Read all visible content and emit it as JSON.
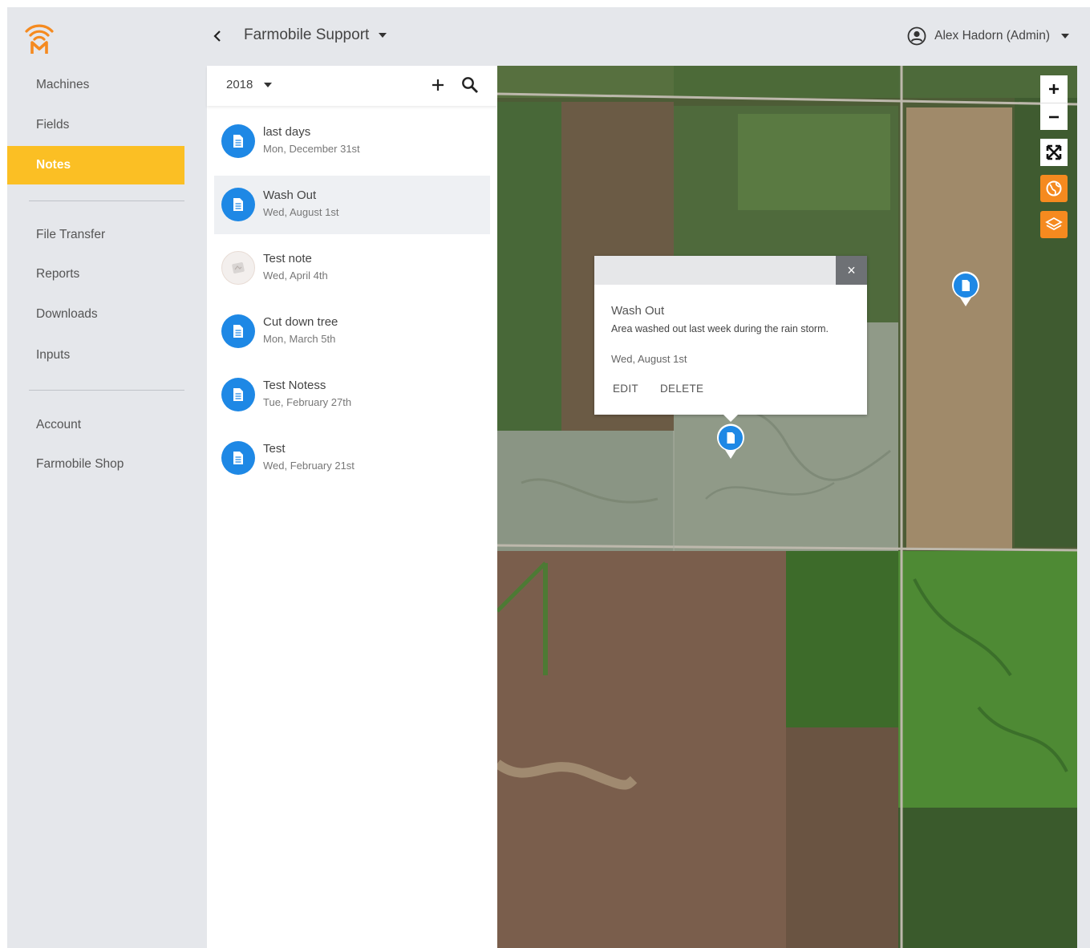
{
  "app": {
    "logo_icon": "farmobile-wifi-logo-icon",
    "brand_color": "#f58a1f"
  },
  "sidebar": {
    "accent": "#fbbf24",
    "items": [
      {
        "label": "Machines"
      },
      {
        "label": "Fields"
      },
      {
        "label": "Notes",
        "active": true
      },
      {
        "label": "File Transfer"
      },
      {
        "label": "Reports"
      },
      {
        "label": "Downloads"
      },
      {
        "label": "Inputs"
      },
      {
        "label": "Account"
      },
      {
        "label": "Farmobile Shop"
      }
    ]
  },
  "header": {
    "back_icon": "chevron-left-icon",
    "org_name": "Farmobile Support",
    "user_name": "Alex Hadorn (Admin)",
    "user_icon": "account-circle-icon"
  },
  "notes": {
    "year": "2018",
    "add_icon": "plus-icon",
    "search_icon": "search-icon",
    "items": [
      {
        "title": "last days",
        "date": "Mon, December 31st",
        "icon": "note-document-icon"
      },
      {
        "title": "Wash Out",
        "date": "Wed, August 1st",
        "icon": "note-document-icon",
        "selected": true
      },
      {
        "title": "Test note",
        "date": "Wed, April 4th",
        "icon": "note-photo-thumbnail"
      },
      {
        "title": "Cut down tree",
        "date": "Mon, March 5th",
        "icon": "note-document-icon"
      },
      {
        "title": "Test Notess",
        "date": "Tue, February 27th",
        "icon": "note-document-icon"
      },
      {
        "title": "Test",
        "date": "Wed, February 21st",
        "icon": "note-document-icon"
      }
    ]
  },
  "map": {
    "controls": [
      "zoom-in-icon",
      "zoom-out-icon",
      "fit-bounds-icon",
      "globe-icon",
      "layers-icon"
    ],
    "pin_color": "#1e88e5",
    "popup": {
      "title": "Wash Out",
      "description": "Area washed out last week during the rain storm.",
      "date": "Wed, August 1st",
      "edit_label": "EDIT",
      "delete_label": "DELETE",
      "close_icon": "close-icon",
      "close_label": "×"
    }
  }
}
